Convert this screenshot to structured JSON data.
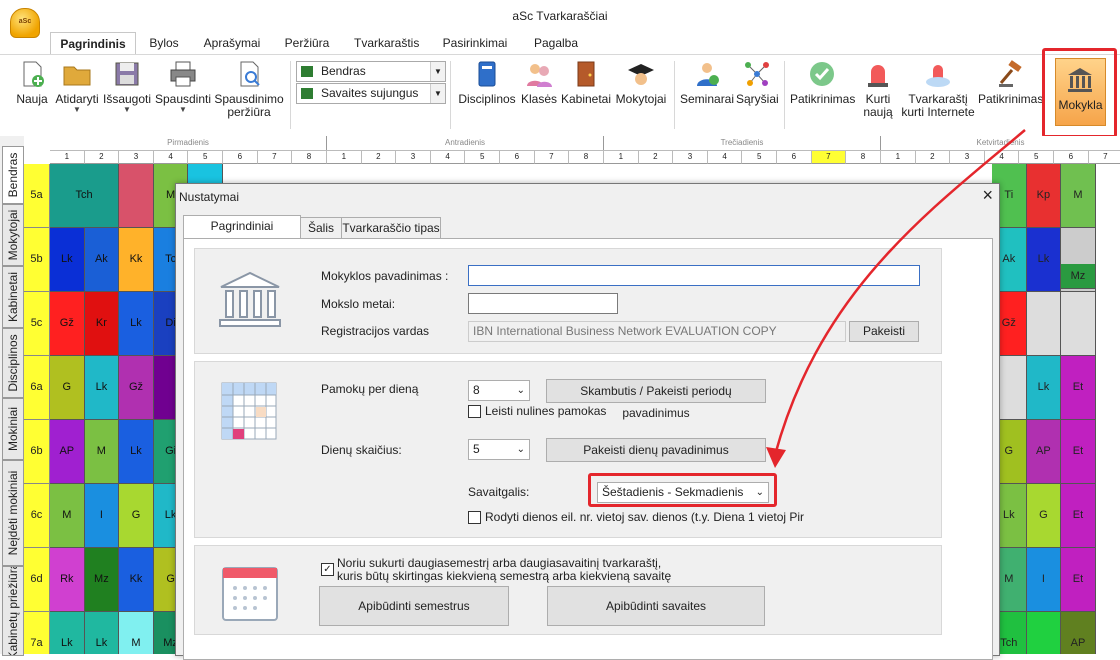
{
  "window": {
    "title": "aSc Tvarkaraščiai",
    "logo_text": "aSc"
  },
  "tabs": [
    "Pagrindinis",
    "Bylos",
    "Aprašymai",
    "Peržiūra",
    "Tvarkaraštis",
    "Pasirinkimai",
    "Pagalba"
  ],
  "ribbon": {
    "nauja": "Nauja",
    "atidaryti": "Atidaryti",
    "issaugoti": "Išsaugoti",
    "spausdinti": "Spausdinti",
    "spausdinimo_1": "Spausdinimo",
    "spausdinimo_2": "peržiūra",
    "combo1": "Bendras",
    "combo2": "Savaites sujungus",
    "disciplinos": "Disciplinos",
    "klases": "Klasės",
    "kabinetai": "Kabinetai",
    "mokytojai": "Mokytojai",
    "seminarai": "Seminarai",
    "sarysiai": "Sąryšiai",
    "patikrinimas1": "Patikrinimas",
    "kurti_1": "Kurti",
    "kurti_2": "naują",
    "internete_1": "Tvarkaraštį",
    "internete_2": "kurti Internete",
    "patikrinimas2": "Patikrinimas",
    "mokykla": "Mokykla"
  },
  "vertical_tabs": [
    "Bendras",
    "Mokytojai",
    "Kabinetai",
    "Disciplinos",
    "Mokiniai",
    "Neįdėti mokiniai",
    "Kabinetų priežiūra"
  ],
  "days": [
    "Pirmadienis",
    "Antradienis",
    "Trečiadienis",
    "Ketvirtadienis"
  ],
  "periods": [
    "1",
    "2",
    "3",
    "4",
    "5",
    "6",
    "7",
    "8"
  ],
  "classes": [
    "5a",
    "5b",
    "5c",
    "6a",
    "6b",
    "6c",
    "6d",
    "7a"
  ],
  "grid_left": [
    [
      "Tch",
      "",
      "M",
      "Ai"
    ],
    [
      "Lk",
      "Ak",
      "Kk",
      "Tc"
    ],
    [
      "Gž",
      "Kr",
      "Lk",
      "Di"
    ],
    [
      "G",
      "Lk",
      "Gž",
      ""
    ],
    [
      "AP",
      "M",
      "Lk",
      "Gi"
    ],
    [
      "M",
      "I",
      "G",
      "Lk"
    ],
    [
      "Rk",
      "Mz",
      "Kk",
      "G"
    ],
    [
      "Lk",
      "Lk",
      "M",
      "Mz"
    ]
  ],
  "grid_right": [
    [
      "Ti",
      "Kp",
      "M"
    ],
    [
      "Ak",
      "Lk",
      ""
    ],
    [
      "Gž",
      "",
      ""
    ],
    [
      "",
      "Lk",
      "Et"
    ],
    [
      "G",
      "AP",
      "Et"
    ],
    [
      "Lk",
      "G",
      "Et"
    ],
    [
      "M",
      "I",
      "Et"
    ],
    [
      "Tch",
      "",
      "AP"
    ]
  ],
  "mz_badge": "Mz",
  "dialog": {
    "title": "Nustatymai",
    "tabs": [
      "Pagrindiniai duomenys",
      "Šalis",
      "Tvarkaraščio tipas"
    ],
    "school_name_label": "Mokyklos pavadinimas :",
    "school_name_value": "",
    "year_label": "Mokslo metai:",
    "year_value": "",
    "reg_label": "Registracijos vardas",
    "reg_value": "IBN International Business Network EVALUATION COPY",
    "change_btn": "Pakeisti",
    "lessons_label": "Pamokų per dieną",
    "lessons_value": "8",
    "bell_btn": "Skambutis / Pakeisti periodų pavadinimus",
    "zero_lessons": "Leisti nulines pamokas",
    "days_label": "Dienų skaičius:",
    "days_value": "5",
    "days_btn": "Pakeisti dienų pavadinimus",
    "weekend_label": "Savaitgalis:",
    "weekend_value": "Šeštadienis - Sekmadienis",
    "day_numbers": "Rodyti dienos eil. nr. vietoj sav. dienos (t.y. Diena 1 vietoj Pir",
    "multi_line1": "Noriu sukurti daugiasemestrį arba daugiasavaitinį tvarkaraštį,",
    "multi_line2": "kuris būtų skirtingas kiekvieną semestrą arba kiekvieną savaitę",
    "semesters_btn": "Apibūdinti semestrus",
    "weeks_btn": "Apibūdinti savaites"
  },
  "colors": {
    "highlight": "#e4262c",
    "row_label": "#ffff33"
  }
}
